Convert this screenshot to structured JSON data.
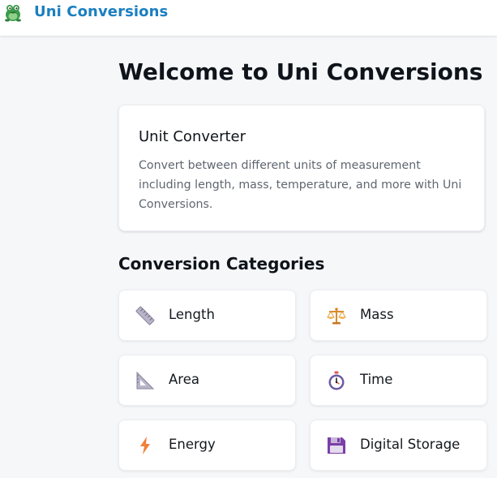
{
  "header": {
    "brand_name": "Uni Conversions",
    "logo_icon": "frog-mascot-icon",
    "brand_color": "#1a7fc0"
  },
  "main": {
    "title": "Welcome to Uni Conversions",
    "info_card": {
      "title": "Unit Converter",
      "description": "Convert between different units of measurement including length, mass, temperature, and more with Uni Conversions."
    },
    "categories_title": "Conversion Categories",
    "categories": [
      {
        "label": "Length",
        "icon": "ruler-icon"
      },
      {
        "label": "Mass",
        "icon": "balance-scale-icon"
      },
      {
        "label": "Area",
        "icon": "triangle-ruler-icon"
      },
      {
        "label": "Time",
        "icon": "stopwatch-icon"
      },
      {
        "label": "Energy",
        "icon": "lightning-bolt-icon"
      },
      {
        "label": "Digital Storage",
        "icon": "floppy-disk-icon"
      }
    ]
  }
}
